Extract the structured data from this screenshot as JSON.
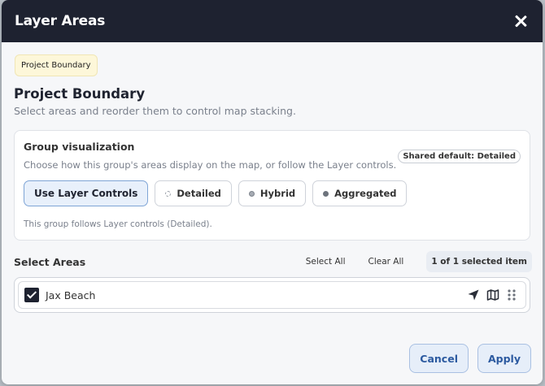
{
  "dialog": {
    "title": "Layer Areas"
  },
  "chip": "Project Boundary",
  "heading": "Project Boundary",
  "subheading": "Select areas and reorder them to control map stacking.",
  "group": {
    "title": "Group visualization",
    "description": "Choose how this group's areas display on the map, or follow the Layer controls.",
    "badge": "Shared default: Detailed",
    "options": [
      {
        "label": "Use Layer Controls",
        "selected": true
      },
      {
        "label": "Detailed",
        "selected": false
      },
      {
        "label": "Hybrid",
        "selected": false
      },
      {
        "label": "Aggregated",
        "selected": false
      }
    ],
    "note": "This group follows Layer controls (Detailed)."
  },
  "areas": {
    "title": "Select Areas",
    "select_all": "Select All",
    "clear_all": "Clear All",
    "count": "1 of 1 selected item",
    "items": [
      {
        "label": "Jax Beach",
        "checked": true
      }
    ]
  },
  "footer": {
    "cancel": "Cancel",
    "apply": "Apply"
  }
}
